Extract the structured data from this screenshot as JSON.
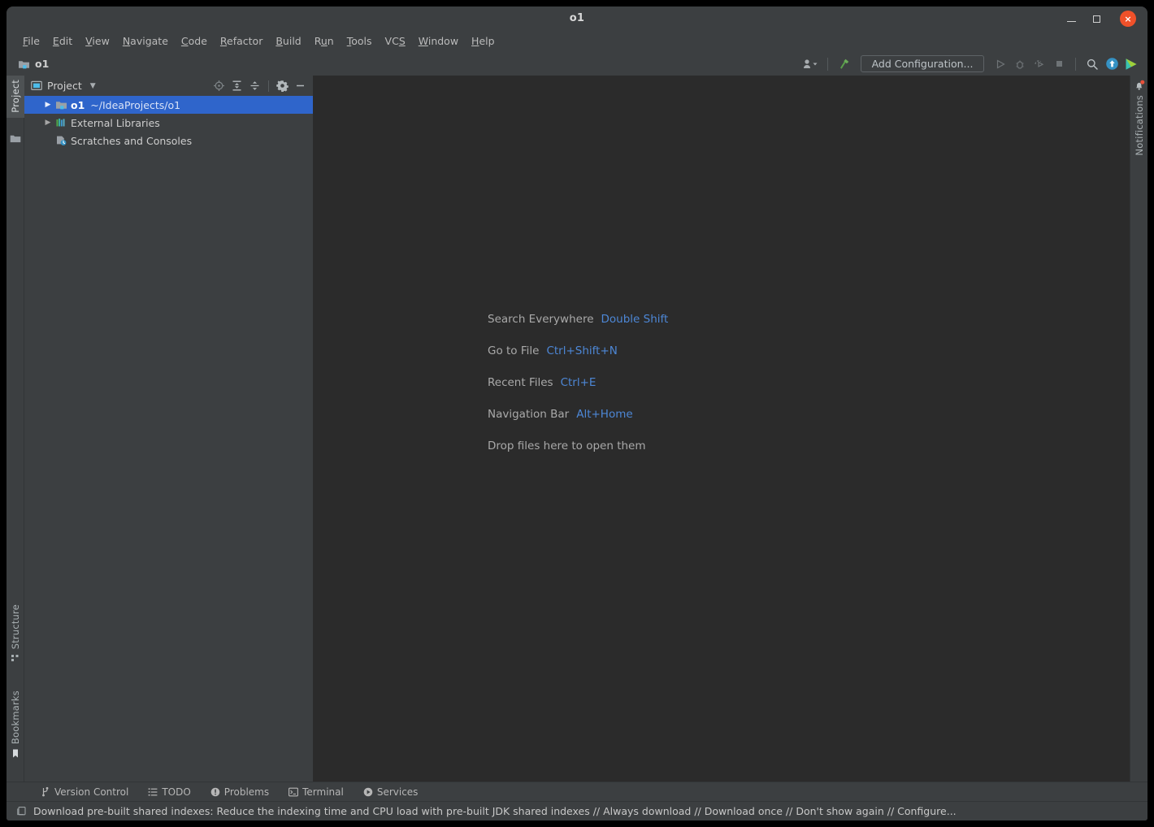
{
  "window": {
    "title": "o1",
    "controls": {
      "minimize": "minimize",
      "maximize": "maximize",
      "close": "×"
    }
  },
  "menubar": {
    "items": [
      {
        "label": "File",
        "mnemonic": "F"
      },
      {
        "label": "Edit",
        "mnemonic": "E"
      },
      {
        "label": "View",
        "mnemonic": "V"
      },
      {
        "label": "Navigate",
        "mnemonic": "N"
      },
      {
        "label": "Code",
        "mnemonic": "C"
      },
      {
        "label": "Refactor",
        "mnemonic": "R"
      },
      {
        "label": "Build",
        "mnemonic": "B"
      },
      {
        "label": "Run",
        "mnemonic": "u"
      },
      {
        "label": "Tools",
        "mnemonic": "T"
      },
      {
        "label": "VCS",
        "mnemonic": "S"
      },
      {
        "label": "Window",
        "mnemonic": "W"
      },
      {
        "label": "Help",
        "mnemonic": "H"
      }
    ]
  },
  "toolbar": {
    "breadcrumb": "o1",
    "add_configuration_label": "Add Configuration...",
    "icons": {
      "account": "account-icon",
      "build": "build-hammer-icon",
      "run": "run-icon",
      "debug": "debug-icon",
      "run_coverage": "run-with-coverage-icon",
      "stop": "stop-icon",
      "search": "search-icon",
      "update": "update-project-icon",
      "ide_play": "ide-play-icon"
    }
  },
  "left_stripe": {
    "top": [
      {
        "label": "Project",
        "icon": "project-icon",
        "active": true
      }
    ],
    "below_icon": "folder-icon",
    "bottom": [
      {
        "label": "Structure",
        "icon": "structure-icon"
      },
      {
        "label": "Bookmarks",
        "icon": "bookmarks-icon"
      }
    ]
  },
  "right_stripe": {
    "items": [
      {
        "label": "Notifications",
        "icon": "bell-icon",
        "badge": true
      }
    ]
  },
  "project_panel": {
    "title": "Project",
    "actions": [
      {
        "name": "select-opened-file",
        "icon": "target-icon"
      },
      {
        "name": "expand-all",
        "icon": "expand-all-icon"
      },
      {
        "name": "collapse-all",
        "icon": "collapse-all-icon"
      },
      {
        "name": "options",
        "icon": "gear-icon"
      },
      {
        "name": "hide",
        "icon": "minimize-icon"
      }
    ],
    "tree": [
      {
        "name": "o1",
        "path": "~/IdeaProjects/o1",
        "icon": "project-folder-icon",
        "expandable": true,
        "selected": true,
        "indent": 0
      },
      {
        "name": "External Libraries",
        "path": "",
        "icon": "libraries-icon",
        "expandable": true,
        "selected": false,
        "indent": 0
      },
      {
        "name": "Scratches and Consoles",
        "path": "",
        "icon": "scratches-icon",
        "expandable": false,
        "selected": false,
        "indent": 0
      }
    ]
  },
  "editor": {
    "hints": [
      {
        "label": "Search Everywhere",
        "shortcut": "Double Shift"
      },
      {
        "label": "Go to File",
        "shortcut": "Ctrl+Shift+N"
      },
      {
        "label": "Recent Files",
        "shortcut": "Ctrl+E"
      },
      {
        "label": "Navigation Bar",
        "shortcut": "Alt+Home"
      },
      {
        "label": "Drop files here to open them",
        "shortcut": ""
      }
    ]
  },
  "bottom_stripe": {
    "items": [
      {
        "label": "Version Control",
        "icon": "vcs-branch-icon"
      },
      {
        "label": "TODO",
        "icon": "todo-list-icon"
      },
      {
        "label": "Problems",
        "icon": "problems-icon"
      },
      {
        "label": "Terminal",
        "icon": "terminal-icon"
      },
      {
        "label": "Services",
        "icon": "services-icon"
      }
    ]
  },
  "statusbar": {
    "icon": "ide-notification-icon",
    "message": "Download pre-built shared indexes: Reduce the indexing time and CPU load with pre-built JDK shared indexes // Always download // Download once // Don't show again // Configure..."
  },
  "colors": {
    "selection_blue": "#2f65cb",
    "panel_bg": "#3c3f41",
    "editor_bg": "#2b2b2b",
    "close_button": "#ef512a",
    "link_blue": "#4d87d6"
  }
}
